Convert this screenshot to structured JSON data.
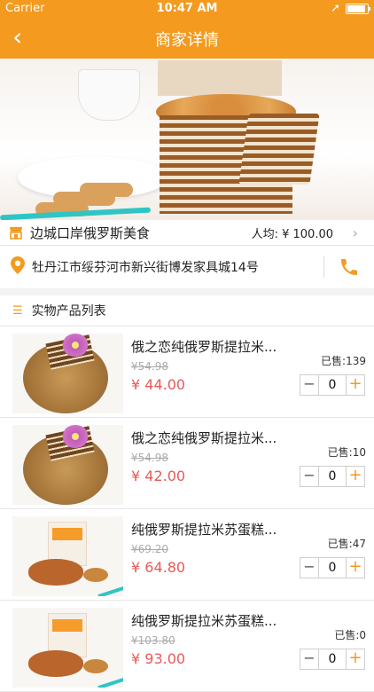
{
  "status": {
    "carrier": "Carrier",
    "time": "10:47 AM"
  },
  "nav": {
    "title": "商家详情"
  },
  "shop": {
    "name": "边城口岸俄罗斯美食",
    "avg_label": "人均: ¥ 100.00",
    "address": "牡丹江市绥芬河市新兴街博发家具城14号"
  },
  "list": {
    "title": "实物产品列表"
  },
  "products": [
    {
      "name": "俄之恋纯俄罗斯提拉米...",
      "orig_price": "¥54.98",
      "price": "¥ 44.00",
      "sold": "已售:139",
      "qty": "0"
    },
    {
      "name": "俄之恋纯俄罗斯提拉米...",
      "orig_price": "¥54.98",
      "price": "¥ 42.00",
      "sold": "已售:10",
      "qty": "0"
    },
    {
      "name": "纯俄罗斯提拉米苏蛋糕...",
      "orig_price": "¥69.20",
      "price": "¥ 64.80",
      "sold": "已售:47",
      "qty": "0"
    },
    {
      "name": "纯俄罗斯提拉米苏蛋糕...",
      "orig_price": "¥103.80",
      "price": "¥ 93.00",
      "sold": "已售:0",
      "qty": "0"
    }
  ],
  "colors": {
    "brand": "#f39a1f",
    "price": "#e85959"
  }
}
